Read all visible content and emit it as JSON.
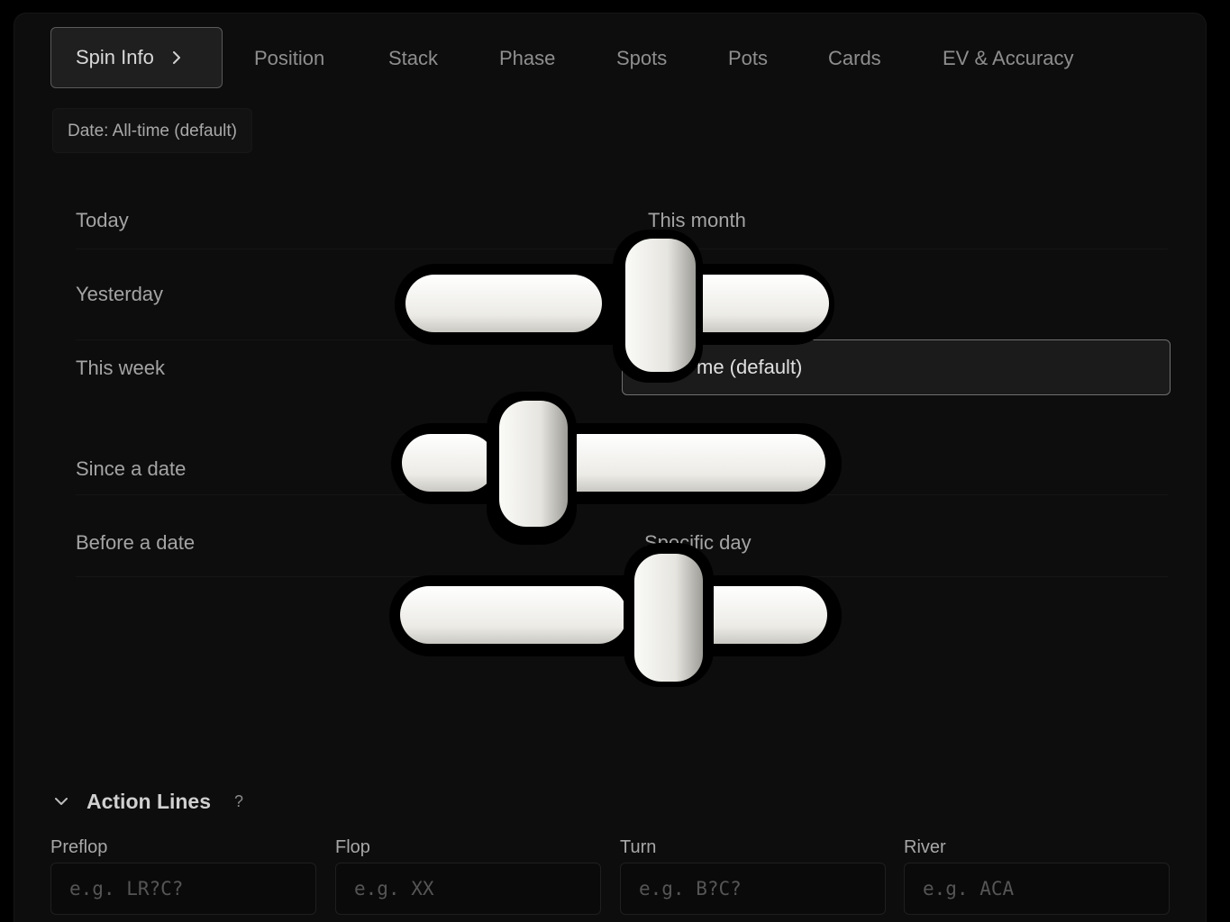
{
  "tabs": {
    "active": "Spin Info",
    "items": [
      "Position",
      "Stack",
      "Phase",
      "Spots",
      "Pots",
      "Cards",
      "EV & Accuracy"
    ]
  },
  "date_filter": {
    "chip": "Date: All-time (default)",
    "options_left": [
      "Today",
      "Yesterday",
      "This week",
      "Since a date",
      "Before a date"
    ],
    "options_right": [
      "This month",
      "me (default)",
      "Specific day"
    ]
  },
  "icons": {
    "overlay": "sliders-icon",
    "tab_chevron": "chevron-right-icon",
    "section_caret": "chevron-down-icon"
  },
  "action_lines": {
    "title": "Action Lines",
    "help": "?",
    "fields": [
      {
        "label": "Preflop",
        "placeholder": "e.g. LR?C?"
      },
      {
        "label": "Flop",
        "placeholder": "e.g. XX"
      },
      {
        "label": "Turn",
        "placeholder": "e.g. B?C?"
      },
      {
        "label": "River",
        "placeholder": "e.g. ACA"
      }
    ]
  },
  "colors": {
    "panel": "#0d0d0d",
    "accent_border": "#707070",
    "text": "#a4a4a4"
  }
}
